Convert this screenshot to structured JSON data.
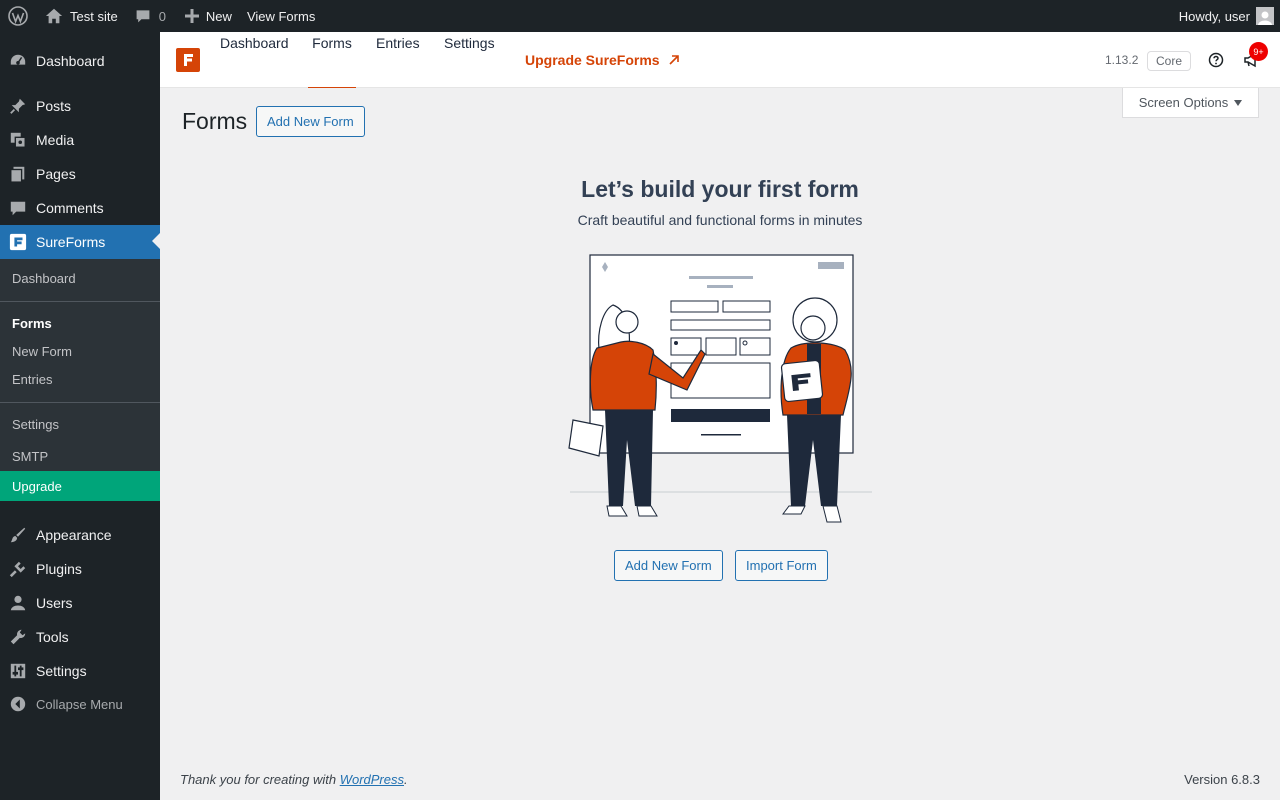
{
  "adminbar": {
    "site_name": "Test site",
    "comments_count": "0",
    "new_label": "New",
    "view_forms_label": "View Forms",
    "howdy": "Howdy, user"
  },
  "sidebar": {
    "items": [
      {
        "label": "Dashboard",
        "icon": "dashboard-icon"
      },
      {
        "label": "Posts",
        "icon": "pin-icon"
      },
      {
        "label": "Media",
        "icon": "media-icon"
      },
      {
        "label": "Pages",
        "icon": "pages-icon"
      },
      {
        "label": "Comments",
        "icon": "comments-icon"
      },
      {
        "label": "SureForms",
        "icon": "sureforms-icon"
      },
      {
        "label": "Appearance",
        "icon": "brush-icon"
      },
      {
        "label": "Plugins",
        "icon": "plug-icon"
      },
      {
        "label": "Users",
        "icon": "users-icon"
      },
      {
        "label": "Tools",
        "icon": "wrench-icon"
      },
      {
        "label": "Settings",
        "icon": "sliders-icon"
      },
      {
        "label": "Collapse Menu",
        "icon": "collapse-icon"
      }
    ],
    "submenu": [
      {
        "label": "Dashboard"
      },
      {
        "label": "Forms"
      },
      {
        "label": "New Form"
      },
      {
        "label": "Entries"
      },
      {
        "label": "Settings"
      },
      {
        "label": "SMTP"
      },
      {
        "label": "Upgrade"
      }
    ]
  },
  "sf_header": {
    "tabs": [
      {
        "label": "Dashboard"
      },
      {
        "label": "Forms"
      },
      {
        "label": "Entries"
      },
      {
        "label": "Settings"
      }
    ],
    "upgrade_label": "Upgrade SureForms",
    "version": "1.13.2",
    "edition": "Core",
    "notification_count": "9+"
  },
  "screen_options_label": "Screen Options",
  "page": {
    "title": "Forms",
    "add_new_label": "Add New Form"
  },
  "empty_state": {
    "title": "Let’s build your first form",
    "subtitle": "Craft beautiful and functional forms in minutes",
    "add_new_label": "Add New Form",
    "import_label": "Import Form"
  },
  "footer": {
    "thanks_prefix": "Thank you for creating with ",
    "wordpress_link": "WordPress",
    "thanks_suffix": ".",
    "version": "Version 6.8.3"
  },
  "colors": {
    "admin_dark": "#1d2327",
    "wp_blue": "#2271b1",
    "sureforms_orange": "#d54407",
    "upgrade_green": "#00a57a"
  }
}
